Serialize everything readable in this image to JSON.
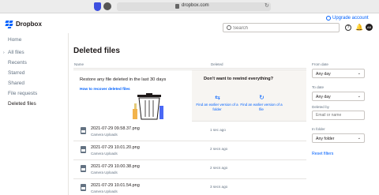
{
  "browser": {
    "url": "dropbox.com",
    "reload_icon": "reload-icon"
  },
  "header": {
    "brand": "Dropbox",
    "upgrade": "Upgrade account",
    "search_placeholder": "Search",
    "help_glyph": "?",
    "avatar_initials": "AB"
  },
  "sidebar": {
    "items": [
      {
        "label": "Home"
      },
      {
        "label": "All files"
      },
      {
        "label": "Recents"
      },
      {
        "label": "Starred"
      },
      {
        "label": "Shared"
      },
      {
        "label": "File requests"
      },
      {
        "label": "Deleted files"
      }
    ],
    "active": "Deleted files"
  },
  "main": {
    "title": "Deleted files",
    "columns": {
      "name": "Name",
      "deleted": "Deleted"
    },
    "promo": {
      "title": "Restore any file deleted in the last 30 days",
      "link": "How to recover deleted files",
      "rewind_title": "Don't want to rewind everything?",
      "option_folder": "Find an earlier version of a folder",
      "option_file": "Find an earlier version of a file"
    },
    "files": [
      {
        "name": "2021-07-29 09.58.37.png",
        "path": "Camera Uploads",
        "deleted": "1 sec ago"
      },
      {
        "name": "2021-07-29 10.01.20.png",
        "path": "Camera Uploads",
        "deleted": "2 secs ago"
      },
      {
        "name": "2021-07-29 10.00.38.png",
        "path": "Camera Uploads",
        "deleted": "2 secs ago"
      },
      {
        "name": "2021-07-29 10.01.54.png",
        "path": "Camera Uploads",
        "deleted": "3 secs ago"
      }
    ]
  },
  "filters": {
    "from_label": "From date",
    "from_value": "Any day",
    "to_label": "To date",
    "to_value": "Any day",
    "deleted_by_label": "Deleted by",
    "deleted_by_placeholder": "Email or name",
    "folder_label": "In folder",
    "folder_value": "Any folder",
    "reset": "Reset filters"
  },
  "colors": {
    "accent": "#0061fe",
    "text": "#1e1919",
    "muted": "#637282"
  }
}
